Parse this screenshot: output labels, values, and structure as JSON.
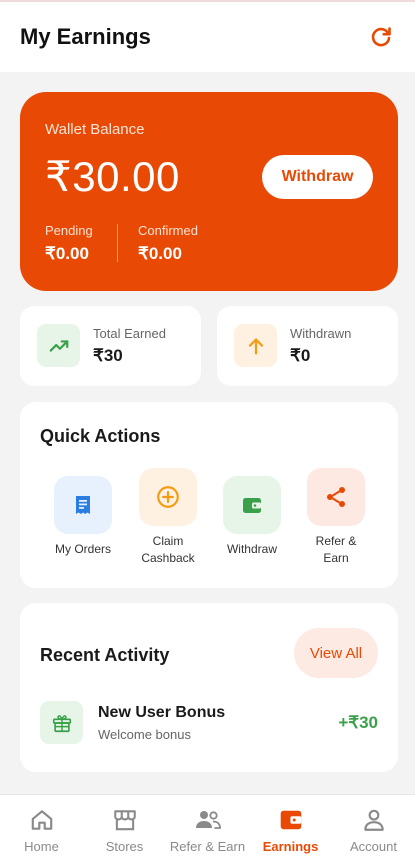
{
  "header": {
    "title": "My Earnings"
  },
  "wallet": {
    "label": "Wallet Balance",
    "balance": "₹30.00",
    "withdraw_label": "Withdraw",
    "pending_label": "Pending",
    "pending_value": "₹0.00",
    "confirmed_label": "Confirmed",
    "confirmed_value": "₹0.00"
  },
  "stats": [
    {
      "label": "Total Earned",
      "value": "₹30",
      "icon": "trending-up-icon"
    },
    {
      "label": "Withdrawn",
      "value": "₹0",
      "icon": "arrow-up-icon"
    }
  ],
  "quick_actions": {
    "heading": "Quick Actions",
    "items": [
      {
        "label": "My Orders",
        "icon": "receipt-icon"
      },
      {
        "label": "Claim Cashback",
        "icon": "plus-circle-icon"
      },
      {
        "label": "Withdraw",
        "icon": "wallet-icon"
      },
      {
        "label": "Refer & Earn",
        "icon": "share-icon"
      }
    ]
  },
  "recent_activity": {
    "heading": "Recent Activity",
    "view_all_label": "View All",
    "items": [
      {
        "title": "New User Bonus",
        "subtitle": "Welcome bonus",
        "amount": "+₹30",
        "icon": "gift-icon"
      }
    ]
  },
  "bottom_nav": [
    {
      "label": "Home",
      "icon": "home-icon"
    },
    {
      "label": "Stores",
      "icon": "store-icon"
    },
    {
      "label": "Refer & Earn",
      "icon": "people-icon"
    },
    {
      "label": "Earnings",
      "icon": "wallet-icon",
      "active": true
    },
    {
      "label": "Account",
      "icon": "person-icon"
    }
  ],
  "colors": {
    "accent": "#e84a05",
    "success": "#3aa14a",
    "background": "#f3f3f3"
  }
}
